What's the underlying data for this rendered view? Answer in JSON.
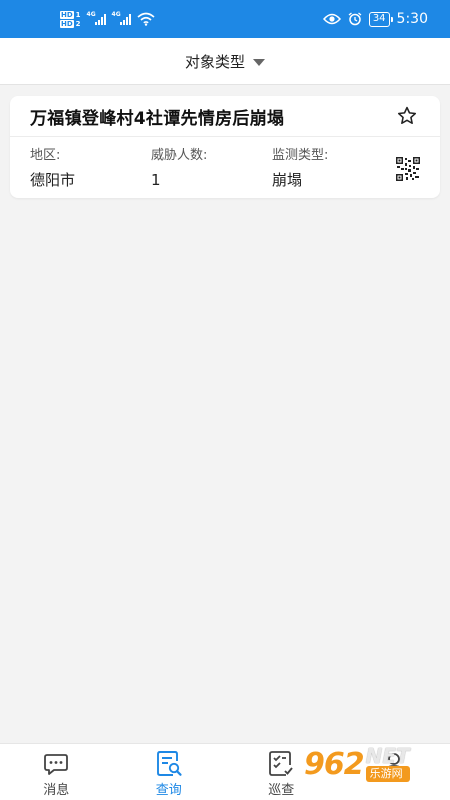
{
  "status_bar": {
    "hd1": "HD",
    "hd1_num": "1",
    "hd2": "HD",
    "hd2_num": "2",
    "net1": "4G",
    "net2": "4G",
    "battery": "34",
    "time": "5:30"
  },
  "header": {
    "filter_label": "对象类型"
  },
  "card": {
    "title": "万福镇登峰村4社谭先情房后崩塌",
    "fields": [
      {
        "label": "地区:",
        "value": "德阳市"
      },
      {
        "label": "威胁人数:",
        "value": "1"
      },
      {
        "label": "监测类型:",
        "value": "崩塌"
      }
    ]
  },
  "bottom_nav": {
    "items": [
      {
        "label": "消息",
        "icon": "message-icon"
      },
      {
        "label": "查询",
        "icon": "search-doc-icon",
        "active": true
      },
      {
        "label": "巡查",
        "icon": "checklist-icon"
      },
      {
        "label": "",
        "icon": "user-icon"
      }
    ]
  },
  "watermark": {
    "num": "962",
    "net": "NET",
    "site": "乐游网"
  },
  "colors": {
    "accent": "#1e88e5",
    "background": "#f3f3f3",
    "watermark": "#f39a1e"
  }
}
